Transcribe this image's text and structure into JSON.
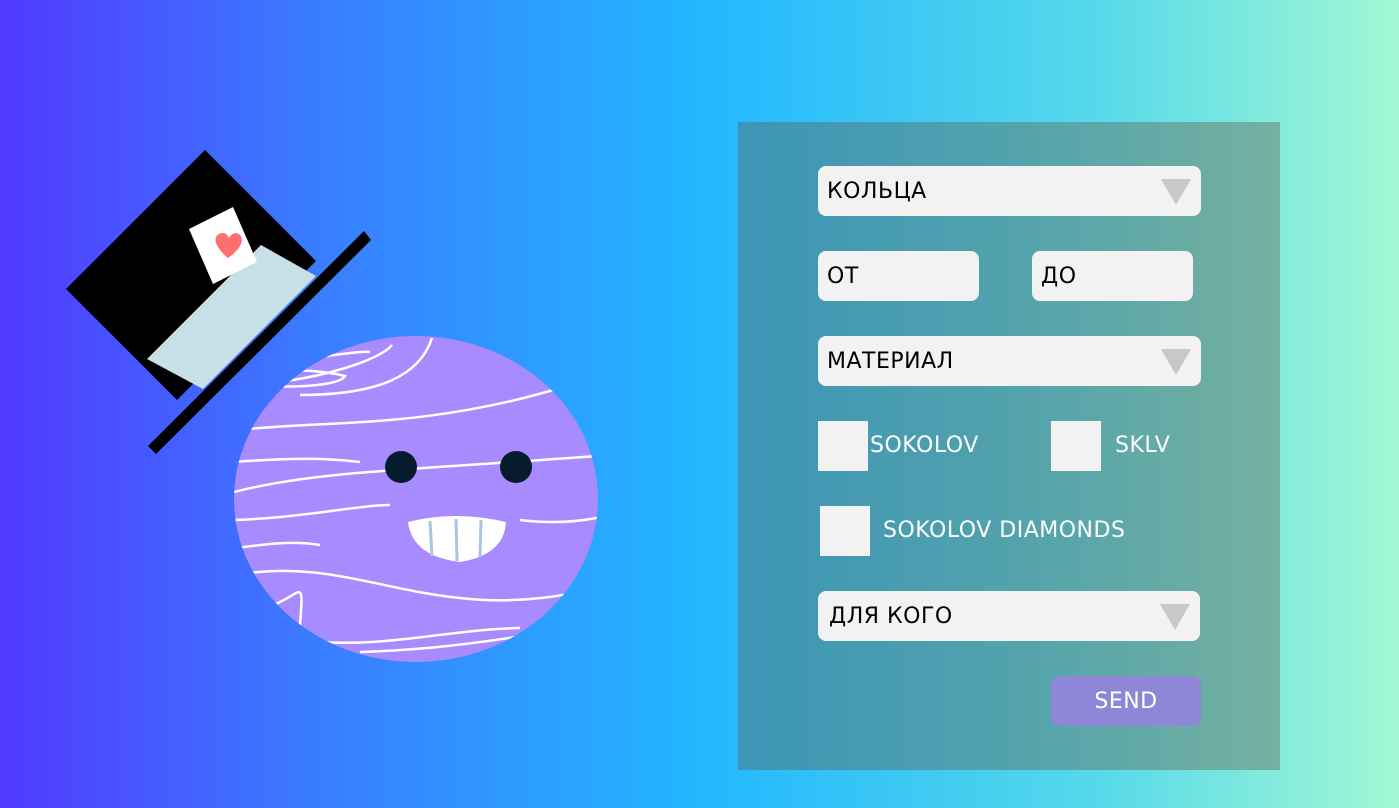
{
  "form": {
    "category": {
      "value": "КОЛЬЦА"
    },
    "price_from": {
      "placeholder": "ОТ"
    },
    "price_to": {
      "placeholder": "ДО"
    },
    "material": {
      "value": "МАТЕРИАЛ"
    },
    "brands": [
      {
        "label": "SOKOLOV",
        "checked": false
      },
      {
        "label": "SKLV",
        "checked": false
      },
      {
        "label": "SOKOLOV DIAMONDS",
        "checked": false
      }
    ],
    "recipient": {
      "value": "ДЛЯ КОГО"
    },
    "send_label": "SEND"
  },
  "colors": {
    "background_start": "#5139ff",
    "background_mid": "#22b7ff",
    "background_end": "#a2f8d3",
    "panel": "#4fa0ae",
    "field": "#f2f2f2",
    "caret": "#c8c8c8",
    "send_button": "#8e86d6",
    "planet": "#a88bff",
    "hat": "#000000",
    "hat_band": "#c8e0e8",
    "heart": "#ff6f6f"
  },
  "icons": [
    "planet-mascot",
    "top-hat-icon",
    "heart-card-icon",
    "dropdown-caret-icon"
  ]
}
